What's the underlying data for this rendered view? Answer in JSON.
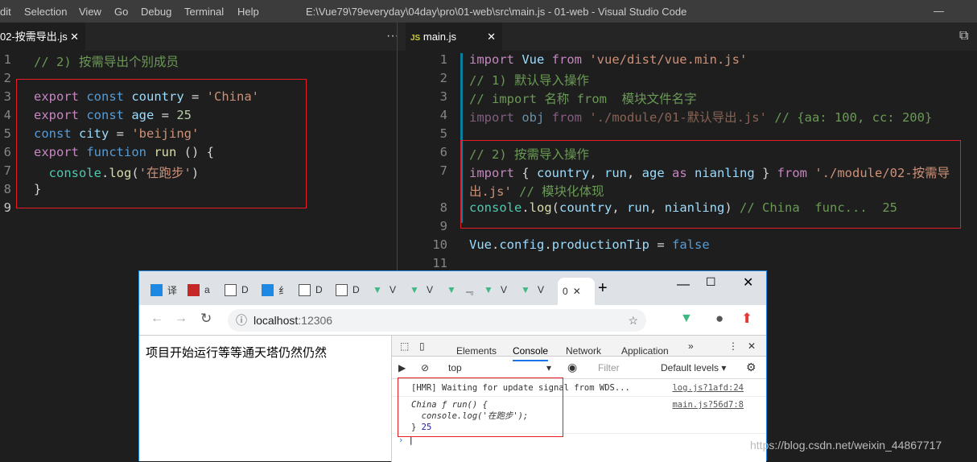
{
  "titlebar": {
    "menu": [
      "dit",
      "Selection",
      "View",
      "Go",
      "Debug",
      "Terminal",
      "Help"
    ],
    "title": "E:\\Vue79\\79everyday\\04day\\pro\\01-web\\src\\main.js - 01-web - Visual Studio Code"
  },
  "left_editor": {
    "tab": "02-按需导出.js",
    "more": "···",
    "lines": [
      [
        [
          "// 2) 按需导出个别成员",
          "cm"
        ]
      ],
      [],
      [
        [
          "export ",
          "kw"
        ],
        [
          "const ",
          "st"
        ],
        [
          "country",
          "vr"
        ],
        [
          " = ",
          "pl"
        ],
        [
          "'China'",
          "str"
        ]
      ],
      [
        [
          "export ",
          "kw"
        ],
        [
          "const ",
          "st"
        ],
        [
          "age",
          "vr"
        ],
        [
          " = ",
          "pl"
        ],
        [
          "25",
          "num"
        ]
      ],
      [
        [
          "const ",
          "st"
        ],
        [
          "city",
          "vr"
        ],
        [
          " = ",
          "pl"
        ],
        [
          "'beijing'",
          "str"
        ]
      ],
      [
        [
          "export ",
          "kw"
        ],
        [
          "function ",
          "st"
        ],
        [
          "run",
          "fn"
        ],
        [
          " () {",
          "pl"
        ]
      ],
      [
        [
          "  console",
          "cls"
        ],
        [
          ".",
          "pl"
        ],
        [
          "log",
          "fn"
        ],
        [
          "(",
          "pl"
        ],
        [
          "'在跑步'",
          "str"
        ],
        [
          ")",
          "pl"
        ]
      ],
      [
        [
          "}",
          "pl"
        ]
      ],
      []
    ]
  },
  "right_editor": {
    "tab": "main.js",
    "tab_icon": "JS",
    "lines": [
      {
        "n": "1",
        "t": [
          [
            "import ",
            "kw"
          ],
          [
            "Vue ",
            "vr"
          ],
          [
            "from ",
            "kw"
          ],
          [
            "'vue/dist/vue.min.js'",
            "str"
          ]
        ]
      },
      {
        "n": "2",
        "t": [
          [
            "// 1) 默认导入操作",
            "cm"
          ]
        ]
      },
      {
        "n": "3",
        "t": [
          [
            "// import 名称 from  模块文件名字",
            "cm"
          ]
        ]
      },
      {
        "n": "4",
        "t": [
          [
            "import ",
            "kw dim"
          ],
          [
            "obj ",
            "vr dim"
          ],
          [
            "from ",
            "kw dim"
          ],
          [
            "'./module/01-默认导出.js'",
            "str dim"
          ],
          [
            " // {aa: 100, cc: 200}",
            "cm"
          ]
        ]
      },
      {
        "n": "5",
        "t": []
      },
      {
        "n": "6",
        "t": [
          [
            "// 2) 按需导入操作",
            "cm"
          ]
        ]
      },
      {
        "n": "7",
        "t": [
          [
            "import ",
            "kw"
          ],
          [
            "{ ",
            "pl"
          ],
          [
            "country",
            "vr"
          ],
          [
            ", ",
            "pl"
          ],
          [
            "run",
            "vr"
          ],
          [
            ", ",
            "pl"
          ],
          [
            "age ",
            "vr"
          ],
          [
            "as ",
            "kw"
          ],
          [
            "nianling ",
            "vr"
          ],
          [
            "} ",
            "pl"
          ],
          [
            "from ",
            "kw"
          ],
          [
            "'./module/02-按需导",
            "str"
          ]
        ]
      },
      {
        "n": "",
        "t": [
          [
            "出.js'",
            "str"
          ],
          [
            " // 模块化体现",
            "cm"
          ]
        ]
      },
      {
        "n": "8",
        "t": [
          [
            "console",
            "cls"
          ],
          [
            ".",
            "pl"
          ],
          [
            "log",
            "fn"
          ],
          [
            "(",
            "pl"
          ],
          [
            "country",
            "vr"
          ],
          [
            ", ",
            "pl"
          ],
          [
            "run",
            "vr"
          ],
          [
            ", ",
            "pl"
          ],
          [
            "nianling",
            "vr"
          ],
          [
            ") ",
            "pl"
          ],
          [
            "// China  func...  25",
            "cm"
          ]
        ]
      },
      {
        "n": "9",
        "t": []
      },
      {
        "n": "10",
        "t": [
          [
            "Vue",
            "vr"
          ],
          [
            ".",
            "pl"
          ],
          [
            "config",
            "vr"
          ],
          [
            ".",
            "pl"
          ],
          [
            "productionTip",
            "vr"
          ],
          [
            " = ",
            "pl"
          ],
          [
            "false",
            "st"
          ]
        ]
      },
      {
        "n": "11",
        "t": []
      }
    ]
  },
  "browser": {
    "tabs": [
      "译",
      "a",
      "D",
      "纟",
      "D",
      "D",
      "V",
      "V",
      "﹃",
      "V",
      "V",
      "0"
    ],
    "active_tab": "0",
    "new_tab": "+",
    "url_host": "localhost",
    "url_port": ":12306",
    "page_text": "项目开始运行等等通天塔仍然仍然",
    "devtools": {
      "tabs": [
        "Elements",
        "Console",
        "Network",
        "Application"
      ],
      "active": "Console",
      "more": "»",
      "context": "top",
      "filter_placeholder": "Filter",
      "levels": "Default levels ▾",
      "messages": [
        {
          "text": "[HMR] Waiting for update signal from WDS...",
          "source": "log.js?1afd:24"
        },
        {
          "text": "China ƒ run() {",
          "source": "main.js?56d7:8",
          "body": "  console.log('在跑步');",
          "tail": "} ",
          "num": "25"
        }
      ]
    }
  },
  "watermark": "https://blog.csdn.net/weixin_44867717",
  "colors": {
    "accent": "#1e88e5",
    "redbox": "#e51c23",
    "vue": "#41b883"
  }
}
